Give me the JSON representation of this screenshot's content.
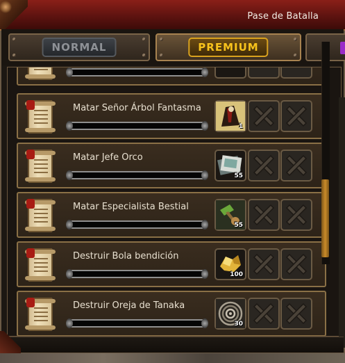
{
  "window": {
    "title": "Pase de Batalla"
  },
  "tabs": [
    {
      "label": "NORMAL",
      "active": false
    },
    {
      "label": "PREMIUM",
      "active": true
    }
  ],
  "quests": [
    {
      "name": "",
      "progress": 0,
      "reward_icon": "partial-reward-icon",
      "reward_qty": ""
    },
    {
      "name": "Matar Señor Árbol Fantasma",
      "progress": 0,
      "reward_icon": "dark-cloak-item-icon",
      "reward_qty": "1"
    },
    {
      "name": "Matar Jefe Orco",
      "progress": 0,
      "reward_icon": "card-stack-item-icon",
      "reward_qty": "55"
    },
    {
      "name": "Matar Especialista Bestial",
      "progress": 0,
      "reward_icon": "green-hammer-item-icon",
      "reward_qty": "55"
    },
    {
      "name": "Destruir Bola bendición",
      "progress": 0,
      "reward_icon": "gold-ore-item-icon",
      "reward_qty": "100"
    },
    {
      "name": "Destruir Oreja de Tanaka",
      "progress": 0,
      "reward_icon": "spiral-item-icon",
      "reward_qty": "30"
    }
  ],
  "locked_slot_icon": "locked-x-icon",
  "colors": {
    "title_bar": "#5e1310",
    "premium_text": "#f7c21c",
    "normal_text": "#8e9196",
    "row_border": "#8a7046",
    "scroll_thumb": "#c98b2a"
  }
}
